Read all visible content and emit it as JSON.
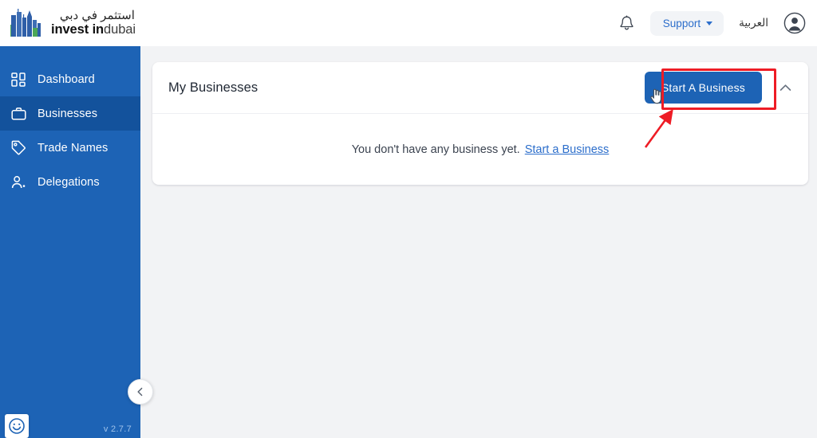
{
  "header": {
    "logo": {
      "arabic_text": "استثمر في دبي",
      "english_bold": "invest in",
      "english_light": "dubai",
      "icon": "dubai-skyline-icon",
      "color_blue": "#2f5fa8",
      "color_green": "#4ca758"
    },
    "notifications_icon": "bell-icon",
    "support": {
      "label": "Support",
      "icon": "chevron-down-icon",
      "color": "#2c6ecb"
    },
    "language_toggle": "العربية",
    "account_icon": "user-avatar-icon"
  },
  "sidebar": {
    "background": "#1d63b5",
    "active_background": "#13529c",
    "items": [
      {
        "label": "Dashboard",
        "icon": "grid-dashboard-icon",
        "active": false
      },
      {
        "label": "Businesses",
        "icon": "briefcase-icon",
        "active": true
      },
      {
        "label": "Trade Names",
        "icon": "tag-icon",
        "active": false
      },
      {
        "label": "Delegations",
        "icon": "user-group-icon",
        "active": false
      }
    ],
    "collapse_icon": "chevron-left-icon",
    "version": "v 2.7.7",
    "feedback_icon": "smiley-face-icon"
  },
  "main": {
    "card": {
      "title": "My Businesses",
      "primary_button": {
        "label": "Start A Business",
        "color": "#1d63b5"
      },
      "collapse_icon": "chevron-up-icon",
      "empty_state": {
        "message": "You don't have any business yet.",
        "link_label": "Start a Business",
        "link_color": "#2c6ecb"
      }
    }
  },
  "annotations": {
    "highlight_color": "#ee1c25",
    "highlight_target": "Start A Business",
    "arrow_color": "#ee1c25",
    "cursor_icon": "pointing-hand-cursor"
  }
}
